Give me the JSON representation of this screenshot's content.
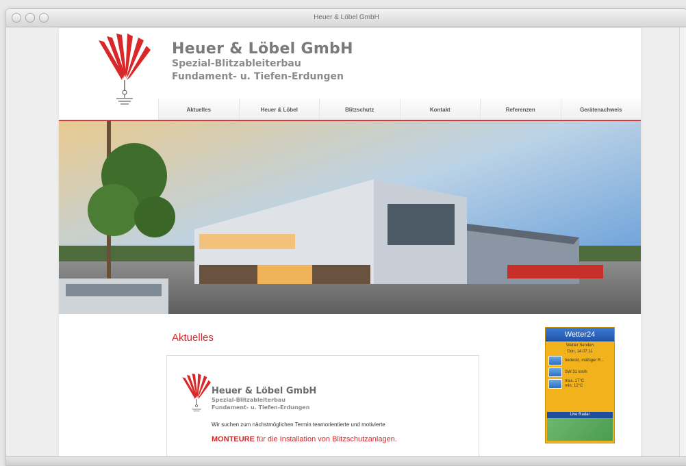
{
  "window": {
    "title": "Heuer & Löbel GmbH"
  },
  "site": {
    "brand_name": "Heuer & Löbel GmbH",
    "brand_sub1": "Spezial-Blitzableiterbau",
    "brand_sub2": "Fundament- u. Tiefen-Erdungen"
  },
  "nav": [
    {
      "label": "Aktuelles"
    },
    {
      "label": "Heuer & Löbel"
    },
    {
      "label": "Blitzschutz"
    },
    {
      "label": "Kontakt"
    },
    {
      "label": "Referenzen"
    },
    {
      "label": "Gerätenachweis"
    }
  ],
  "content": {
    "title": "Aktuelles",
    "card": {
      "brand_name": "Heuer & Löbel GmbH",
      "sub1": "Spezial-Blitzableiterbau",
      "sub2": "Fundament- u. Tiefen-Erdungen",
      "text": "Wir suchen zum nächstmöglichen Termin teamorientierte und motivierte",
      "highlight_bold": "MONTEURE",
      "highlight_rest": "für die Installation von Blitzschutzanlagen."
    }
  },
  "weather": {
    "title": "Wetter24",
    "city": "Wetter Senden",
    "date": "Don, 14.07.11",
    "sky": "bedeckt, mäßiger R...",
    "wind": "SW 31 km/h",
    "max": "max. 17°C",
    "min": "min. 12°C",
    "radar_label": "Live Radar"
  },
  "colors": {
    "accent": "#d22a2a",
    "widget_orange": "#f2b21b",
    "widget_blue": "#1e53a9"
  }
}
